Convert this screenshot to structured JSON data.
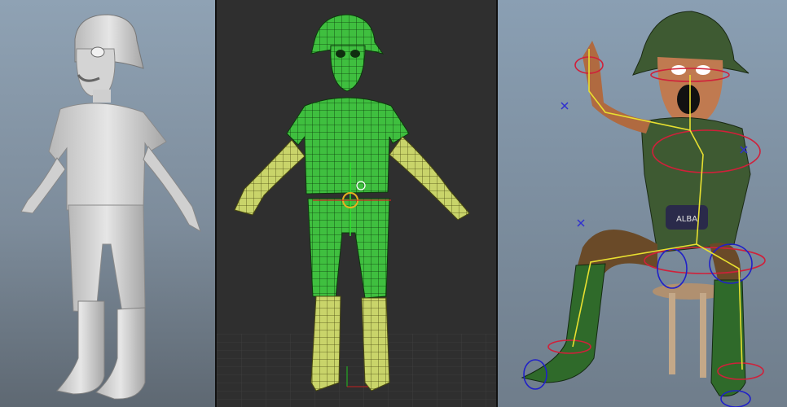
{
  "panels": [
    {
      "name": "sculpt-render",
      "model": "untextured-gray-character"
    },
    {
      "name": "wireframe-topology",
      "model": "green-quad-mesh-character"
    },
    {
      "name": "rigged-textured",
      "model": "textured-seated-character-with-rig-controls"
    }
  ],
  "colors": {
    "viewport_blue": "#8fa2b4",
    "viewport_dark": "#2f2f2f",
    "mesh_green": "#3fbf3f",
    "mesh_yellow": "#c9d46a",
    "rig_red": "#d0203a",
    "rig_yellow": "#e8e030",
    "rig_blue": "#2020c8",
    "texture_green": "#3e5a32"
  },
  "decal": {
    "text": "ALBA"
  }
}
